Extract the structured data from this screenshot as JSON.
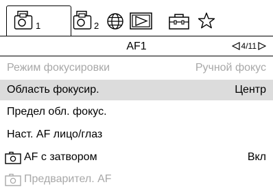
{
  "tabs": [
    {
      "icon": "camera-icon",
      "number": "1",
      "active": true
    },
    {
      "icon": "camera-icon",
      "number": "2",
      "active": false
    },
    {
      "icon": "globe-icon",
      "active": false
    },
    {
      "icon": "playback-icon",
      "active": false
    },
    {
      "icon": "toolbox-icon",
      "active": false
    },
    {
      "icon": "star-icon",
      "active": false
    }
  ],
  "header": {
    "title": "AF1",
    "page": "4/11",
    "prev_icon": "triangle-left-icon",
    "next_icon": "triangle-right-icon"
  },
  "menu": {
    "items": [
      {
        "label": "Режим фокусировки",
        "value": "Ручной фокус",
        "disabled": true
      },
      {
        "label": "Область фокусир.",
        "value": "Центр",
        "selected": true
      },
      {
        "label": "Предел обл. фокус.",
        "value": ""
      },
      {
        "label": "Наст. AF лицо/глаз",
        "value": ""
      },
      {
        "label": "AF с затвором",
        "value": "Вкл",
        "icon": "shutter-camera-icon"
      },
      {
        "label": "Предварител. AF",
        "value": "",
        "icon": "shutter-camera-icon",
        "disabled": true
      }
    ]
  },
  "colors": {
    "selected_bg": "#dcdcdc",
    "disabled_text": "#a8a8a8"
  }
}
